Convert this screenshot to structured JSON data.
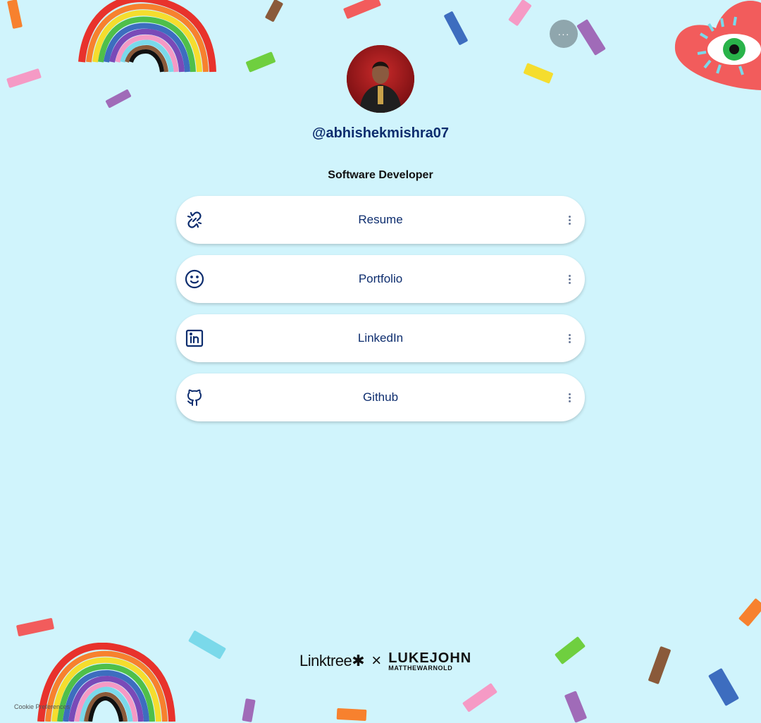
{
  "profile": {
    "handle": "@abhishekmishra07",
    "bio": "Software Developer"
  },
  "links": [
    {
      "label": "Resume",
      "icon": "link-icon"
    },
    {
      "label": "Portfolio",
      "icon": "smiley-icon"
    },
    {
      "label": "LinkedIn",
      "icon": "linkedin-icon"
    },
    {
      "label": "Github",
      "icon": "github-icon"
    }
  ],
  "header": {
    "more_label": "···"
  },
  "footer": {
    "linktree": "Linktree✱",
    "separator": "×",
    "partner_line1": "LUKEJOHN",
    "partner_line2": "MATTHEWARNOLD",
    "cookie": "Cookie Preferences"
  },
  "colors": {
    "background": "#d0f4fc",
    "text_accent": "#0d2d6e",
    "button_bg": "#ffffff"
  }
}
